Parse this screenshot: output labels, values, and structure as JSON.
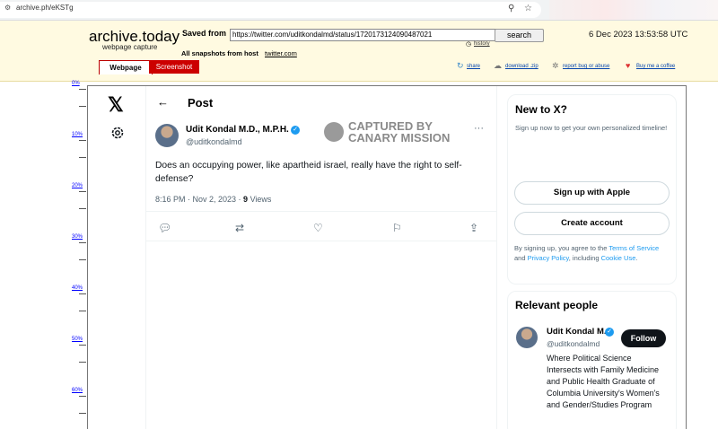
{
  "browser": {
    "url": "archive.ph/eKSTg",
    "icons": {
      "zoom": "zoom-icon",
      "star": "star-icon"
    }
  },
  "archive": {
    "logo": "archive.today",
    "logo_sub": "webpage capture",
    "saved_from_label": "Saved from",
    "saved_url": "https://twitter.com/uditkondalmd/status/1720173124090487021",
    "search_label": "search",
    "history_label": "history",
    "timestamp": "6 Dec 2023 13:53:58 UTC",
    "all_snapshots_label": "All snapshots  from host",
    "host": "twitter.com",
    "tabs": {
      "webpage": "Webpage",
      "screenshot": "Screenshot"
    },
    "actions": {
      "share": "share",
      "download": "download .zip",
      "report": "report bug or abuse",
      "donate": "Buy me a coffee"
    }
  },
  "ruler": [
    "0%",
    "10%",
    "20%",
    "30%",
    "40%",
    "50%",
    "60%"
  ],
  "tweet": {
    "header_title": "Post",
    "author_name": "Udit Kondal M.D., M.P.H.",
    "author_handle": "@uditkondalmd",
    "watermark_line1": "CAPTURED BY",
    "watermark_line2": "CANARY MISSION",
    "text": "Does an occupying power, like apartheid israel, really have the right to self-defense?",
    "time": "8:16 PM · Nov 2, 2023 · ",
    "views_count": "9",
    "views_label": " Views",
    "more": "···"
  },
  "sidebar": {
    "title": "New to X?",
    "subtitle": "Sign up now to get your own personalized timeline!",
    "apple_label": "Sign up with Apple",
    "create_label": "Create account",
    "terms_prefix": "By signing up, you agree to the ",
    "terms_link": "Terms of Service",
    "terms_mid": " and ",
    "privacy_link": "Privacy Policy",
    "terms_mid2": ", including ",
    "cookie_link": "Cookie Use",
    "terms_end": "."
  },
  "relevant": {
    "title": "Relevant people",
    "name": "Udit Kondal M.D., M.P.H.",
    "handle": "@uditkondalmd",
    "follow_label": "Follow",
    "bio": "Where Political Science Intersects with Family Medicine and Public Health Graduate of Columbia University's Women's and Gender/Studies Program"
  },
  "colors": {
    "accent": "#1d9bf0",
    "archive_bg": "#fffae1",
    "tab_red": "#cc0000"
  }
}
